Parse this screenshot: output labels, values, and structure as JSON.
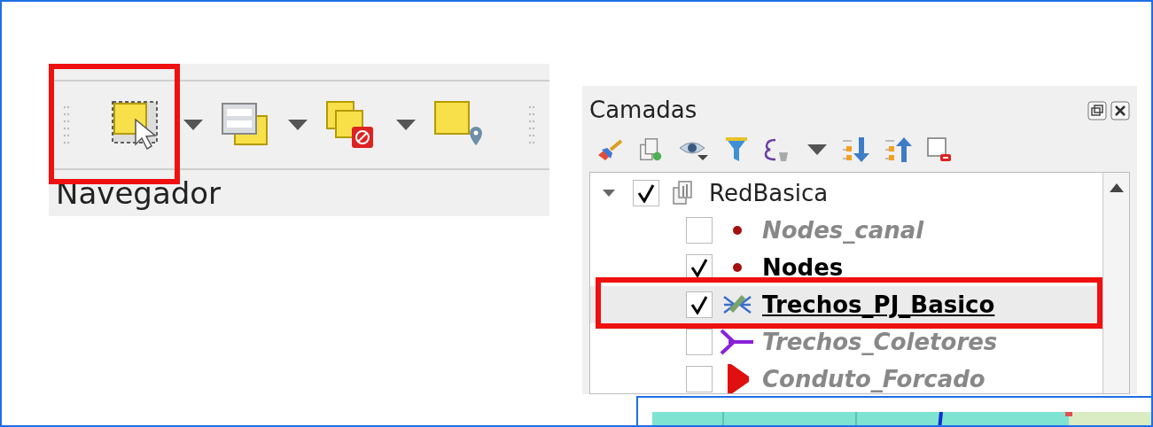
{
  "toolbar": {
    "dock_title": "Navegador"
  },
  "layers_panel": {
    "title": "Camadas",
    "tree": [
      {
        "name": "RedBasica",
        "kind": "group",
        "checked": true,
        "expanded": true,
        "selected": false,
        "children": [
          {
            "name": "Nodes_canal",
            "kind": "point",
            "checked": false,
            "selected": false
          },
          {
            "name": "Nodes",
            "kind": "point",
            "checked": true,
            "selected": false
          },
          {
            "name": "Trechos_PJ_Basico",
            "kind": "network",
            "checked": true,
            "selected": true
          },
          {
            "name": "Trechos_Coletores",
            "kind": "line",
            "checked": false,
            "selected": false
          },
          {
            "name": "Conduto_Forcado",
            "kind": "flag",
            "checked": false,
            "selected": false
          }
        ]
      }
    ]
  }
}
